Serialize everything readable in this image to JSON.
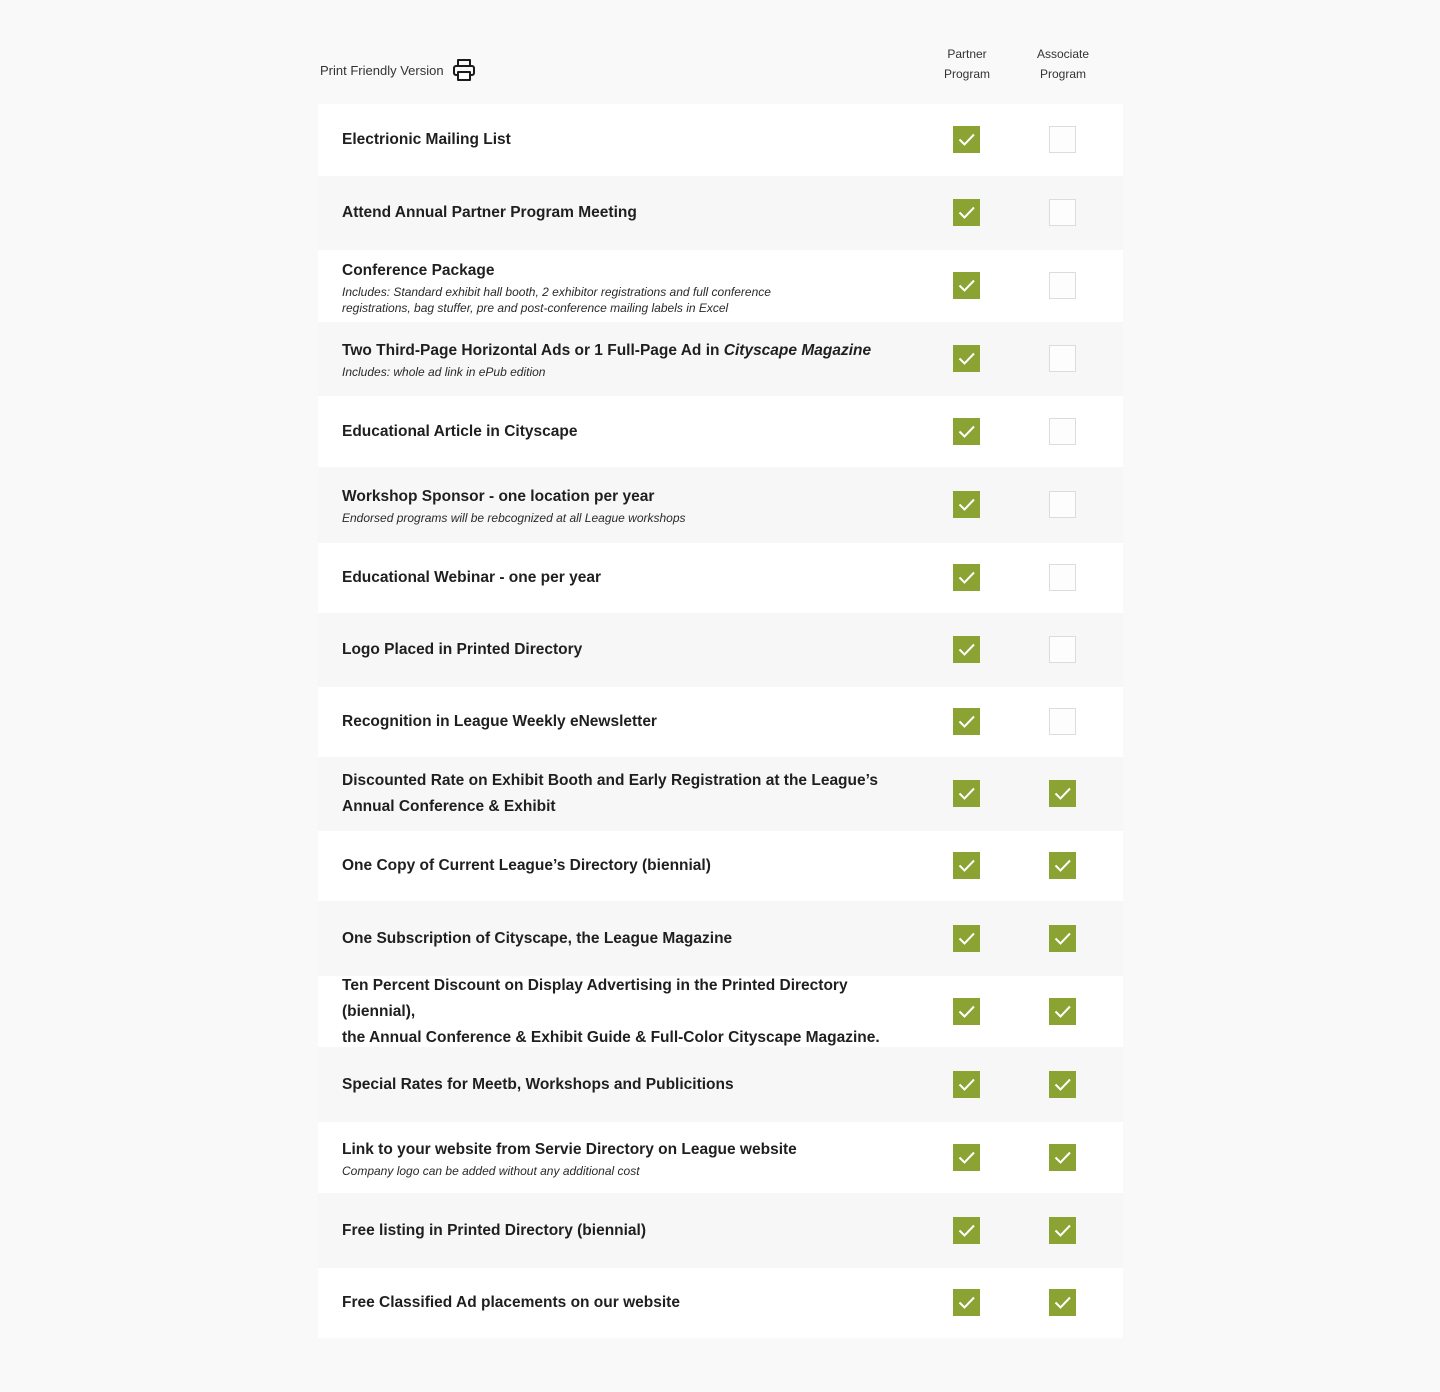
{
  "header": {
    "print_label": "Print Friendly Version",
    "print_icon": "printer-icon",
    "col_partner_line1": "Partner",
    "col_partner_line2": "Program",
    "col_associate_line1": "Associate",
    "col_associate_line2": "Program"
  },
  "colors": {
    "check_green": "#8aa332",
    "page_bg": "#f9f9f9",
    "row_white": "#ffffff",
    "row_grey": "#f7f7f7"
  },
  "rows": [
    {
      "title": "Electrionic Mailing List",
      "title_italic": "",
      "sub": "",
      "sub2": "",
      "partner": true,
      "associate": false
    },
    {
      "title": "Attend Annual Partner Program Meeting",
      "title_italic": "",
      "sub": "",
      "sub2": "",
      "partner": true,
      "associate": false
    },
    {
      "title": "Conference Package",
      "title_italic": "",
      "sub": "Includes: Standard exhibit hall booth, 2 exhibitor registrations and full conference",
      "sub2": "registrations, bag stuffer, pre and post-conference mailing labels in Excel",
      "partner": true,
      "associate": false
    },
    {
      "title": "Two Third-Page Horizontal Ads or 1 Full-Page Ad in ",
      "title_italic": "Cityscape Magazine",
      "sub": "Includes: whole ad link in ePub edition",
      "sub2": "",
      "partner": true,
      "associate": false
    },
    {
      "title": "Educational Article in Cityscape",
      "title_italic": "",
      "sub": "",
      "sub2": "",
      "partner": true,
      "associate": false
    },
    {
      "title": "Workshop Sponsor - one location per year",
      "title_italic": "",
      "sub": "Endorsed programs will be rebcognized at all League workshops",
      "sub2": "",
      "partner": true,
      "associate": false
    },
    {
      "title": "Educational Webinar - one per year",
      "title_italic": "",
      "sub": "",
      "sub2": "",
      "partner": true,
      "associate": false
    },
    {
      "title": "Logo Placed in Printed Directory",
      "title_italic": "",
      "sub": "",
      "sub2": "",
      "partner": true,
      "associate": false
    },
    {
      "title": "Recognition in League Weekly eNewsletter",
      "title_italic": "",
      "sub": "",
      "sub2": "",
      "partner": true,
      "associate": false
    },
    {
      "title": "Discounted Rate on Exhibit Booth and Early Registration at the League’s",
      "title2": "Annual Conference & Exhibit",
      "title_italic": "",
      "sub": "",
      "sub2": "",
      "partner": true,
      "associate": true
    },
    {
      "title": "One Copy of Current League’s Directory (biennial)",
      "title_italic": "",
      "sub": "",
      "sub2": "",
      "partner": true,
      "associate": true
    },
    {
      "title": "One Subscription of Cityscape, the League Magazine",
      "title_italic": "",
      "sub": "",
      "sub2": "",
      "partner": true,
      "associate": true
    },
    {
      "title": "Ten Percent Discount on Display Advertising in the Printed Directory (biennial),",
      "title2": "the Annual Conference & Exhibit Guide & Full-Color Cityscape Magazine.",
      "title_italic": "",
      "sub": "",
      "sub2": "",
      "partner": true,
      "associate": true
    },
    {
      "title": "Special Rates for Meetb, Workshops and Publicitions",
      "title_italic": "",
      "sub": "",
      "sub2": "",
      "partner": true,
      "associate": true
    },
    {
      "title": "Link to your website from Servie Directory on League website",
      "title_italic": "",
      "sub": "Company logo can be added without any additional cost",
      "sub2": "",
      "partner": true,
      "associate": true
    },
    {
      "title": "Free listing in Printed Directory (biennial)",
      "title_italic": "",
      "sub": "",
      "sub2": "",
      "partner": true,
      "associate": true
    },
    {
      "title": "Free Classified Ad placements on our website",
      "title_italic": "",
      "sub": "",
      "sub2": "",
      "partner": true,
      "associate": true
    }
  ]
}
